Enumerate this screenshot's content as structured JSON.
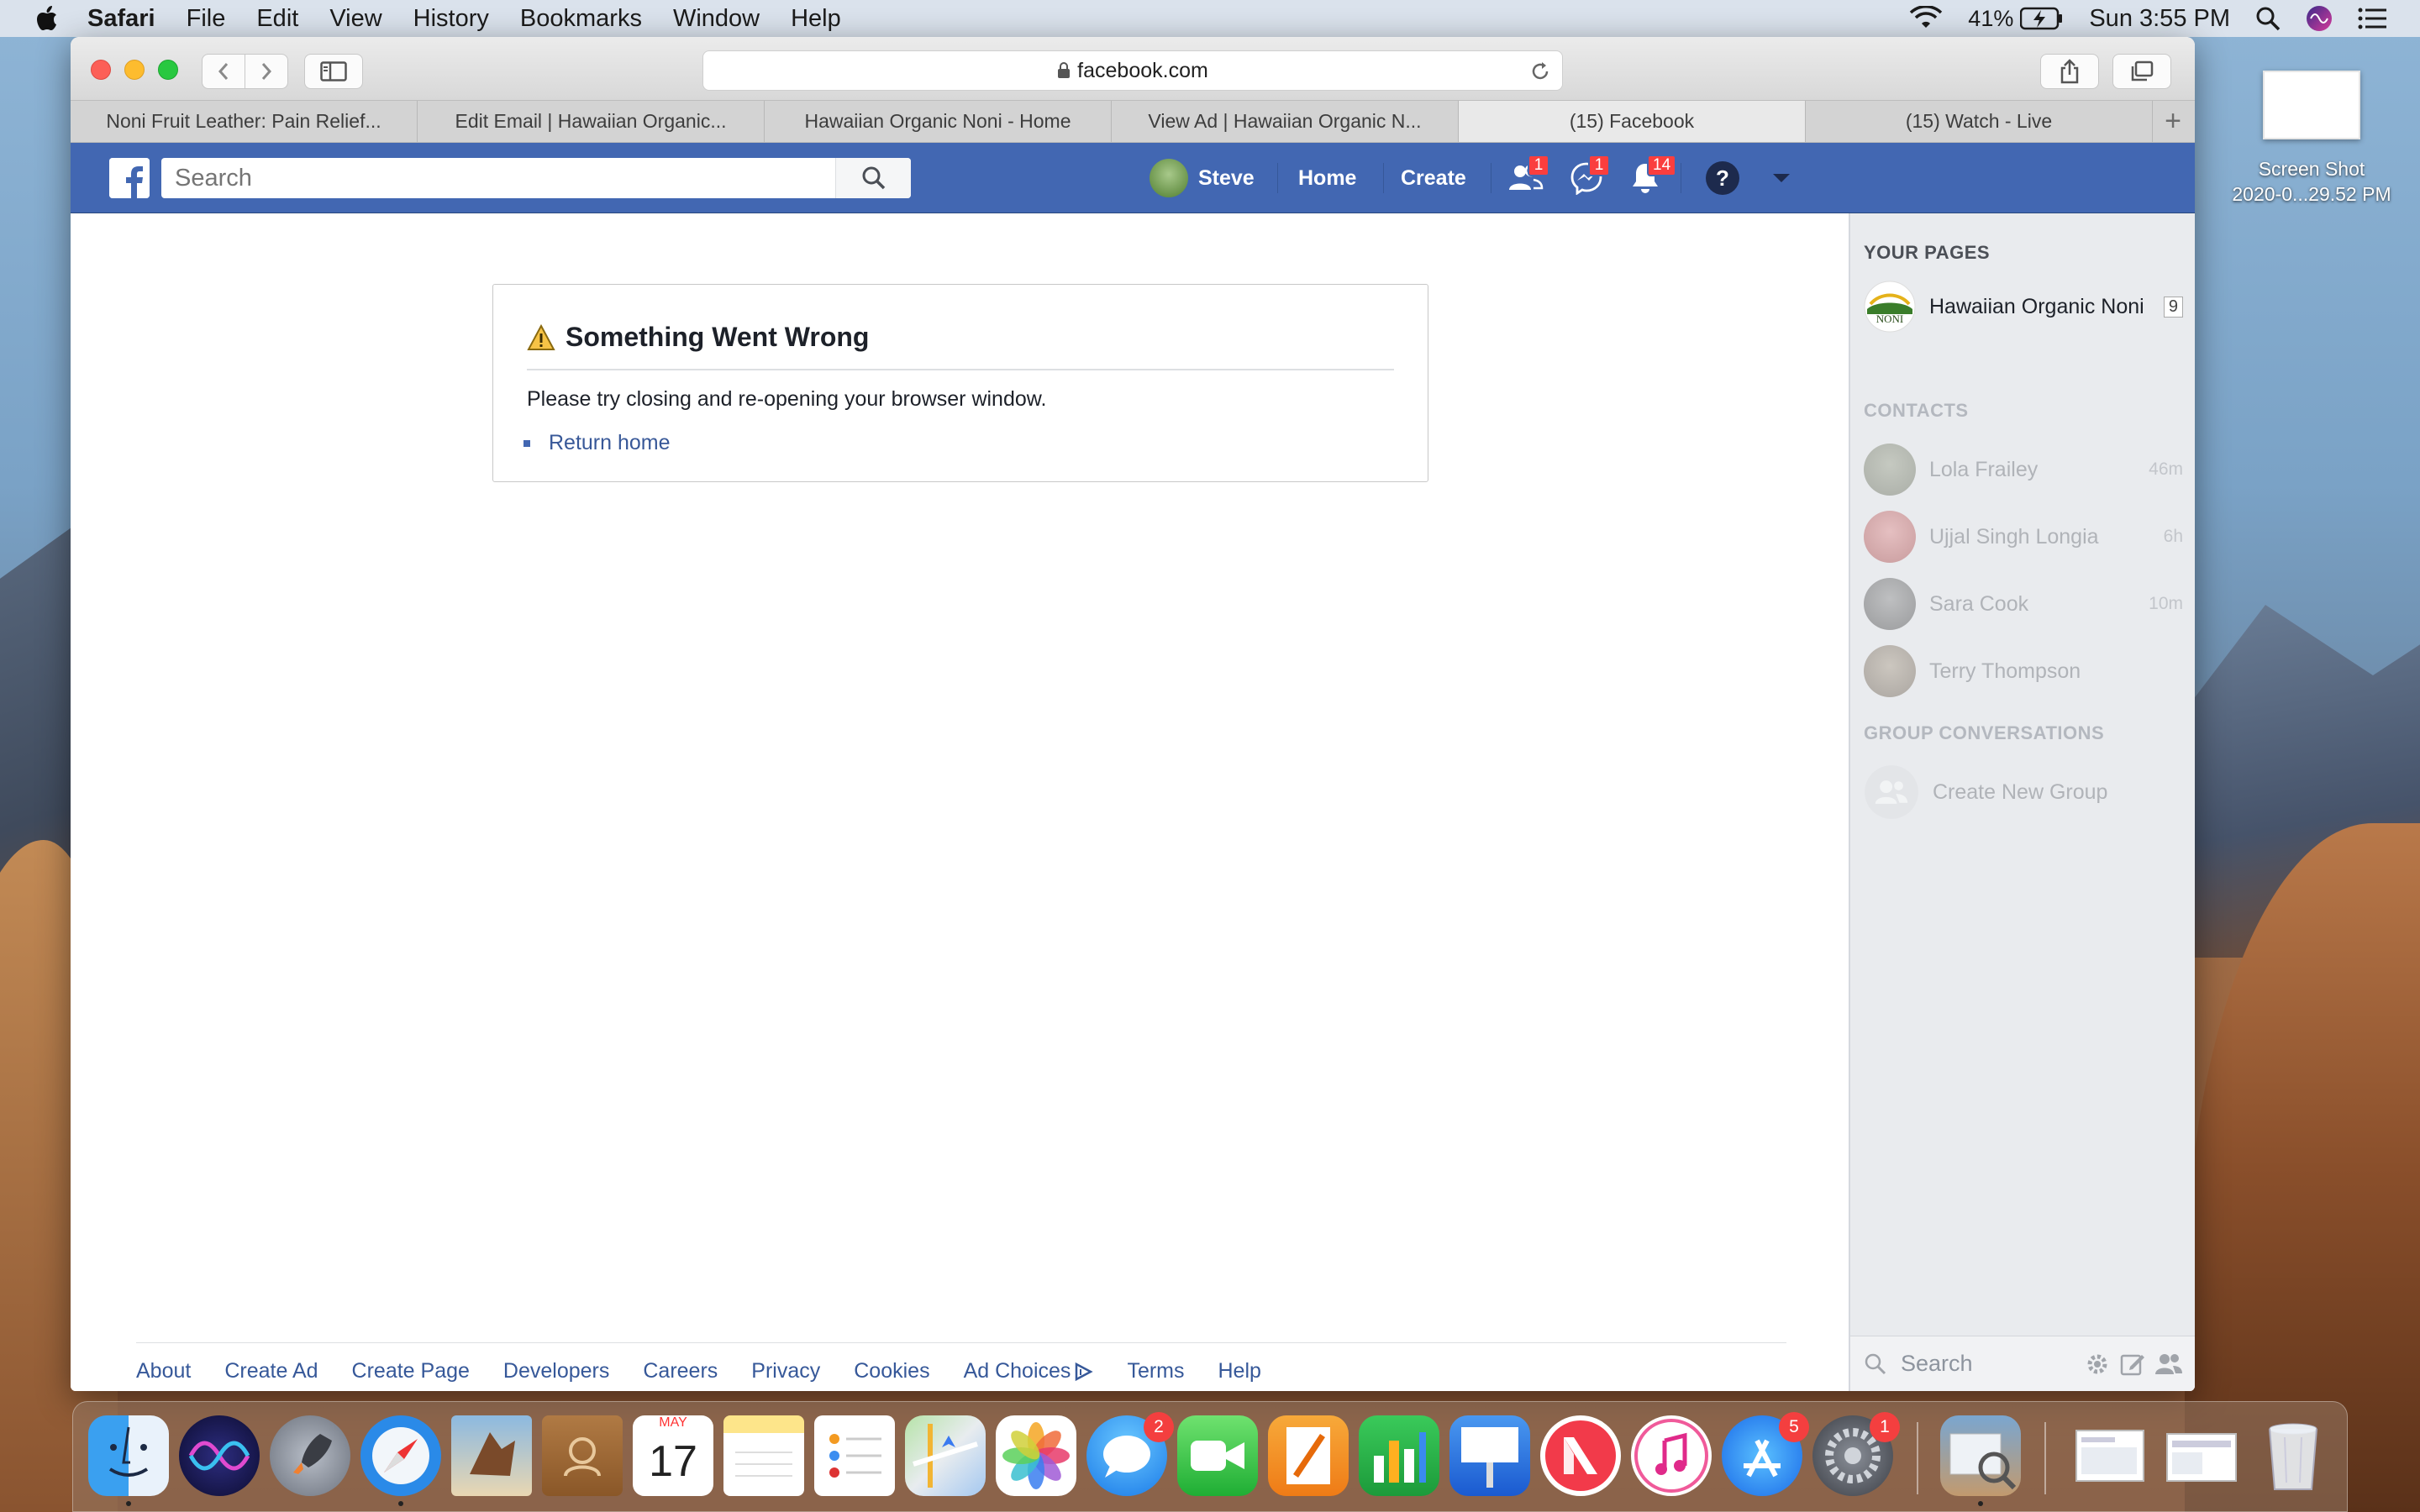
{
  "menubar": {
    "app_name": "Safari",
    "items": [
      "File",
      "Edit",
      "View",
      "History",
      "Bookmarks",
      "Window",
      "Help"
    ],
    "battery": "41%",
    "clock": "Sun 3:55 PM"
  },
  "browser": {
    "url": "facebook.com",
    "tabs": [
      {
        "title": "Noni Fruit Leather: Pain Relief..."
      },
      {
        "title": "Edit Email | Hawaiian Organic..."
      },
      {
        "title": "Hawaiian Organic Noni - Home"
      },
      {
        "title": "View Ad | Hawaiian Organic N..."
      },
      {
        "title": "(15) Facebook"
      },
      {
        "title": "(15) Watch - Live"
      }
    ],
    "new_tab": "+"
  },
  "fb_header": {
    "search_placeholder": "Search",
    "user_name": "Steve",
    "home": "Home",
    "create": "Create",
    "friend_requests_count": "1",
    "messages_count": "1",
    "notifications_count": "14"
  },
  "error": {
    "title": "Something Went Wrong",
    "message": "Please try closing and re-opening your browser window.",
    "link": "Return home"
  },
  "footer": {
    "links": [
      "About",
      "Create Ad",
      "Create Page",
      "Developers",
      "Careers",
      "Privacy",
      "Cookies",
      "Ad Choices",
      "Terms",
      "Help"
    ]
  },
  "sidebar": {
    "your_pages_heading": "YOUR PAGES",
    "page_name": "Hawaiian Organic Noni",
    "page_count": "9",
    "contacts_heading": "CONTACTS",
    "contacts": [
      {
        "name": "Lola Frailey",
        "time": "46m"
      },
      {
        "name": "Ujjal Singh Longia",
        "time": "6h"
      },
      {
        "name": "Sara Cook",
        "time": "10m"
      },
      {
        "name": "Terry Thompson",
        "time": ""
      }
    ],
    "group_heading": "GROUP CONVERSATIONS",
    "create_group": "Create New Group",
    "search_label": "Search"
  },
  "desktop_file": {
    "line1": "Screen Shot",
    "line2": "2020-0...29.52 PM"
  },
  "dock": {
    "messages_badge": "2",
    "calendar_month": "MAY",
    "calendar_day": "17",
    "appstore_badge": "5",
    "prefs_badge": "1"
  }
}
